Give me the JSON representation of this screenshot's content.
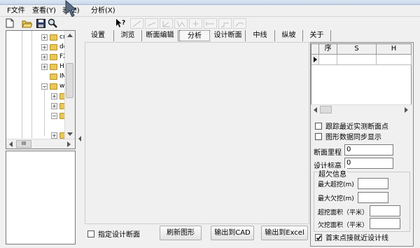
{
  "menu": {
    "items": [
      "F文件",
      "查看(Y)",
      "表(Z)",
      "分析(X)"
    ]
  },
  "tree": {
    "nodes": [
      {
        "text": "cr",
        "expander": "+"
      },
      {
        "text": "dc",
        "expander": "+"
      },
      {
        "text": "FX",
        "expander": "+"
      },
      {
        "text": "HI",
        "expander": "+"
      },
      {
        "text": "IM",
        "expander": ""
      },
      {
        "text": "wi",
        "expander": "−"
      },
      {
        "text": "",
        "expander": "+"
      },
      {
        "text": "",
        "expander": "+"
      },
      {
        "text": "",
        "expander": "−"
      },
      {
        "text": "",
        "expander": "+"
      }
    ],
    "hscroll_label": "III"
  },
  "tabs": [
    "设置",
    "浏览",
    "断面编辑",
    "分析",
    "设计断面",
    "中线",
    "纵坡",
    "关于"
  ],
  "active_tab": "分析",
  "canvas": {
    "design_section_checkbox_label": "指定设计断面",
    "refresh_button": "刷新图形",
    "export_cad_button": "输出到CAD",
    "export_excel_button": "输出到Excel"
  },
  "grid": {
    "columns": [
      "序",
      "S",
      "H"
    ]
  },
  "right_panel": {
    "track_checkbox_label": "跟踪最近实测断面点",
    "sync_checkbox_label": "图形数据同步显示",
    "chainage_label": "断面里程",
    "chainage_value": "0",
    "design_elev_label": "设计标高",
    "design_elev_value": "0",
    "group_title": "超欠信息",
    "max_over_label": "最大超挖(m)",
    "max_under_label": "最大欠挖(m)",
    "over_area_label": "超挖面积（平米）",
    "under_area_label": "欠挖面积（平米）",
    "snap_checkbox_label": "首末点接就近设计线",
    "snap_checked": true
  }
}
